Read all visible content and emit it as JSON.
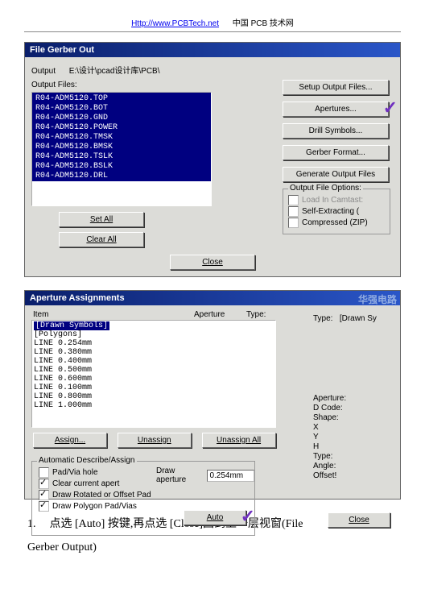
{
  "header": {
    "link": "Http://www.PCBTech.net",
    "cn": "中国 PCB 技术网"
  },
  "gerber_dialog": {
    "title": "File Gerber Out",
    "output_label": "Output",
    "output_path": "E:\\设计\\pcad设计库\\PCB\\",
    "output_files_label": "Output Files:",
    "files": [
      "R04-ADM5120.TOP",
      "R04-ADM5120.BOT",
      "R04-ADM5120.GND",
      "R04-ADM5120.POWER",
      "R04-ADM5120.TMSK",
      "R04-ADM5120.BMSK",
      "R04-ADM5120.TSLK",
      "R04-ADM5120.BSLK",
      "R04-ADM5120.DRL"
    ],
    "buttons": {
      "setup": "Setup Output Files...",
      "apertures": "Apertures...",
      "drill": "Drill Symbols...",
      "format": "Gerber Format...",
      "generate": "Generate Output Files"
    },
    "options": {
      "legend": "Output File Options:",
      "load": "Load In Camtast:",
      "self": "Self-Extracting (",
      "zip": "Compressed (ZIP)"
    },
    "set_all": "Set All",
    "clear_all": "Clear All",
    "close": "Close"
  },
  "aperture_dialog": {
    "title": "Aperture Assignments",
    "watermark": "华强电路",
    "col_item": "Item",
    "col_aperture": "Aperture",
    "col_type": "Type:",
    "type_val": "[Drawn Sy",
    "list": [
      "[Drawn Symbols]",
      "[Polygons]",
      "LINE 0.254mm",
      "LINE 0.380mm",
      "LINE 0.400mm",
      "LINE 0.500mm",
      "LINE 0.600mm",
      "LINE 0.100mm",
      "LINE 0.800mm",
      "LINE 1.000mm"
    ],
    "right": {
      "hdr": "Aperture:",
      "dcode": "D Code:",
      "shape": "Shape:",
      "x": "X",
      "y": "Y",
      "h": "H",
      "type": "Type:",
      "angle": "Angle:",
      "offset": "Offset!"
    },
    "assign": "Assign...",
    "unassign": "Unassign",
    "unassign_all": "Unassign All",
    "ada": {
      "legend": "Automatic Describe/Assign",
      "pad": "Pad/Via hole",
      "clear": "Clear current apert",
      "rotate": "Draw Rotated or Offset Pad",
      "polygon": "Draw Polygon Pad/Vias",
      "draw_ap": "Draw aperture",
      "value": "0.254mm",
      "auto": "Auto"
    },
    "close": "Close"
  },
  "body": {
    "num": "1.",
    "text1": "点选  [Auto]  按键,再点选  [Close]回到上一层视窗(File",
    "text2": "Gerber Output)"
  }
}
